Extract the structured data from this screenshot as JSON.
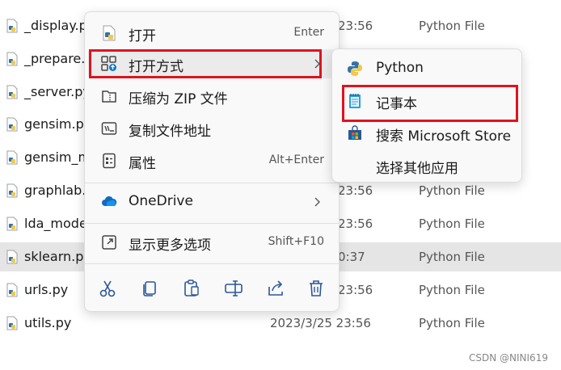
{
  "files": [
    {
      "name": "_display.p",
      "date": "23:56",
      "type": "Python File",
      "selected": false
    },
    {
      "name": "_prepare.p",
      "date": "",
      "type": "",
      "selected": false
    },
    {
      "name": "_server.py",
      "date": "",
      "type": "",
      "selected": false
    },
    {
      "name": "gensim.py",
      "date": "",
      "type": "",
      "selected": false
    },
    {
      "name": "gensim_m",
      "date": "",
      "type": "",
      "selected": false
    },
    {
      "name": "graphlab.p",
      "date": "23:56",
      "type": "Python File",
      "selected": false
    },
    {
      "name": "lda_mode",
      "date": "23:56",
      "type": "Python File",
      "selected": false
    },
    {
      "name": "sklearn.py",
      "date": "0:37",
      "type": "Python File",
      "selected": true
    },
    {
      "name": "urls.py",
      "date": "23:56",
      "type": "Python File",
      "selected": false
    },
    {
      "name": "utils.py",
      "date": "2023/3/25 23:56",
      "type": "Python File",
      "selected": false
    }
  ],
  "menu": {
    "open": {
      "label": "打开",
      "shortcut": "Enter",
      "icon": "python-file-icon"
    },
    "open_with": {
      "label": "打开方式",
      "icon": "open-with-icon"
    },
    "compress": {
      "label": "压缩为 ZIP 文件",
      "icon": "zip-icon"
    },
    "copy_path": {
      "label": "复制文件地址",
      "icon": "copy-path-icon"
    },
    "properties": {
      "label": "属性",
      "shortcut": "Alt+Enter",
      "icon": "properties-icon"
    },
    "onedrive": {
      "label": "OneDrive",
      "icon": "onedrive-cloud-icon"
    },
    "more_options": {
      "label": "显示更多选项",
      "shortcut": "Shift+F10",
      "icon": "more-options-icon"
    },
    "toolbar": [
      "cut-icon",
      "copy-icon",
      "paste-icon",
      "rename-icon",
      "share-icon",
      "delete-icon"
    ]
  },
  "submenu": {
    "python": {
      "label": "Python",
      "icon": "python-icon"
    },
    "notepad": {
      "label": "记事本",
      "icon": "notepad-icon"
    },
    "store": {
      "label": "搜索 Microsoft Store",
      "icon": "microsoft-store-icon"
    },
    "other": {
      "label": "选择其他应用"
    }
  },
  "colors": {
    "highlight": "#e0121f",
    "accent": "#0078d4"
  },
  "watermark": "CSDN @NINI619"
}
